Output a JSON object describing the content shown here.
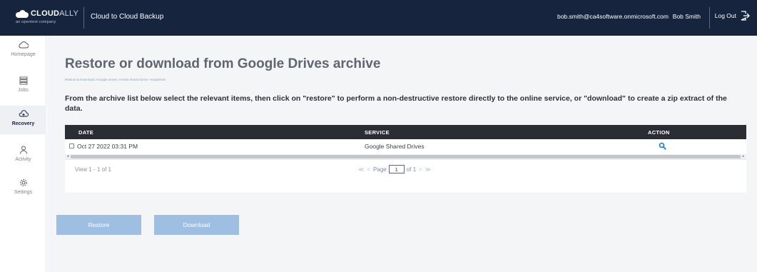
{
  "header": {
    "brand_bold": "CLOUD",
    "brand_light": "ALLY",
    "brand_sub": "an opentext company",
    "app_title": "Cloud to Cloud Backup",
    "user_email": "bob.smith@ca4software.onmicrosoft.com",
    "user_name": "Bob Smith",
    "logout_label": "Log Out"
  },
  "sidebar": {
    "items": [
      {
        "label": "Homepage",
        "icon": "cloud-icon"
      },
      {
        "label": "Jobs",
        "icon": "jobs-icon"
      },
      {
        "label": "Recovery",
        "icon": "recovery-icon",
        "active": true
      },
      {
        "label": "Activity",
        "icon": "activity-icon"
      },
      {
        "label": "Settings",
        "icon": "gear-icon"
      }
    ]
  },
  "main": {
    "title": "Restore or download from Google Drives archive",
    "breadcrumb": "Restore & Download >Google Drives >Ariela Shared Drive >snapshots",
    "instructions": "From the archive list below select the relevant items, then click on \"restore\" to perform a non-destructive restore directly to the online service, or \"download\" to create a zip extract of the data.",
    "table": {
      "columns": [
        "DATE",
        "SERVICE",
        "ACTION"
      ],
      "rows": [
        {
          "date": "Oct 27 2022 03:31 PM",
          "service": "Google Shared Drives",
          "action_icon": "search-icon"
        }
      ],
      "view_count": "View 1 - 1 of 1",
      "pager": {
        "first": "≪",
        "prev": "<",
        "page_label": "Page",
        "page_value": "1",
        "of_label": "of 1",
        "next": ">",
        "last": "≫"
      }
    },
    "buttons": {
      "restore": "Restore",
      "download": "Download"
    }
  },
  "colors": {
    "topbar": "#16243d",
    "table_header": "#2a2d33",
    "button": "#9fbfe2",
    "link": "#6f8fc2"
  }
}
